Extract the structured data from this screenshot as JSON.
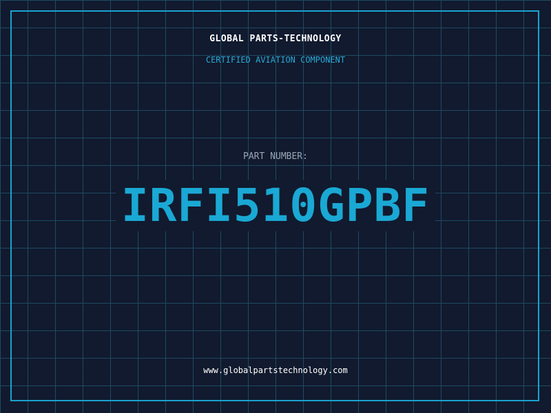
{
  "header": {
    "brand": "GLOBAL PARTS-TECHNOLOGY",
    "tagline": "CERTIFIED AVIATION COMPONENT"
  },
  "part": {
    "label": "PART NUMBER:",
    "number": "IRFI510GPBF"
  },
  "footer": {
    "url": "www.globalpartstechnology.com"
  },
  "colors": {
    "background": "#111a2e",
    "grid": "#1e4a62",
    "accent": "#1aa8d4",
    "text": "#ffffff",
    "muted": "#9aa6b6"
  }
}
